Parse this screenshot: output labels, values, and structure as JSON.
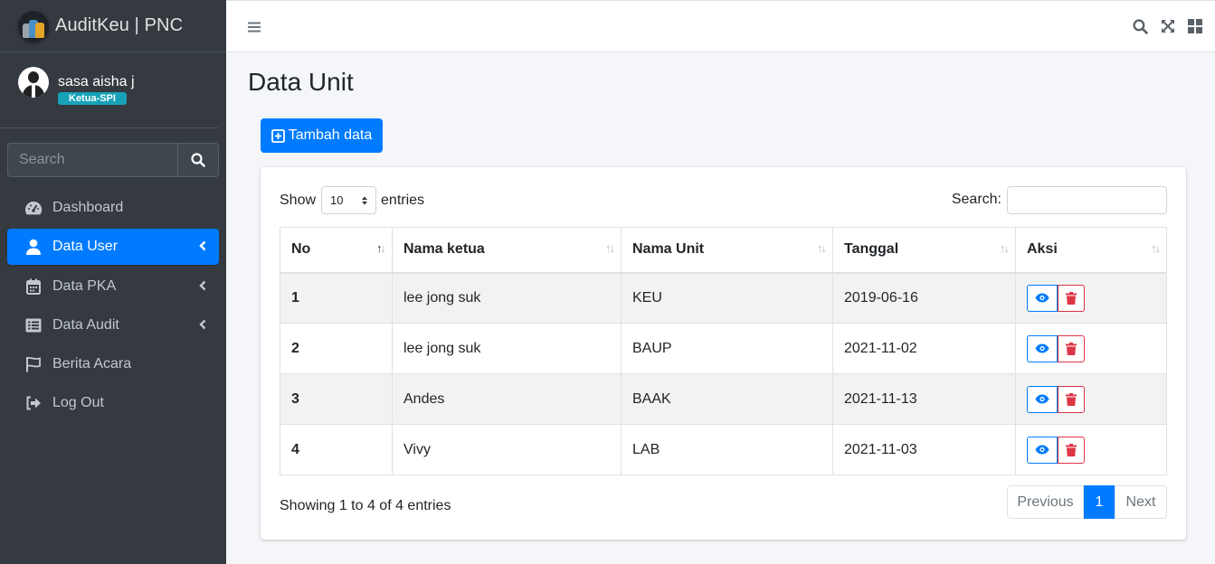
{
  "brand": {
    "title": "AuditKeu | PNC"
  },
  "user": {
    "name": "sasa aisha j",
    "role": "Ketua-SPI"
  },
  "sidebar_search": {
    "placeholder": "Search"
  },
  "nav": [
    {
      "label": "Dashboard",
      "icon": "tachometer-icon",
      "active": false
    },
    {
      "label": "Data User",
      "icon": "user-icon",
      "active": true
    },
    {
      "label": "Data PKA",
      "icon": "calendar-icon",
      "active": false
    },
    {
      "label": "Data Audit",
      "icon": "list-icon",
      "active": false
    },
    {
      "label": "Berita Acara",
      "icon": "flag-icon",
      "active": false
    },
    {
      "label": "Log Out",
      "icon": "sign-out-icon",
      "active": false
    }
  ],
  "page": {
    "title": "Data Unit",
    "add_button": "Tambah data"
  },
  "table_controls": {
    "show_label": "Show",
    "entries_value": "10",
    "entries_label": "entries",
    "search_label": "Search:"
  },
  "table": {
    "headers": [
      "No",
      "Nama ketua",
      "Nama Unit",
      "Tanggal",
      "Aksi"
    ],
    "rows": [
      {
        "no": "1",
        "ketua": "lee jong suk",
        "unit": "KEU",
        "tanggal": "2019-06-16"
      },
      {
        "no": "2",
        "ketua": "lee jong suk",
        "unit": "BAUP",
        "tanggal": "2021-11-02"
      },
      {
        "no": "3",
        "ketua": "Andes",
        "unit": "BAAK",
        "tanggal": "2021-11-13"
      },
      {
        "no": "4",
        "ketua": "Vivy",
        "unit": "LAB",
        "tanggal": "2021-11-03"
      }
    ]
  },
  "footer": {
    "info": "Showing 1 to 4 of 4 entries",
    "prev": "Previous",
    "page": "1",
    "next": "Next"
  },
  "colors": {
    "primary": "#007bff",
    "danger": "#dc3545",
    "sidebar": "#343a40",
    "badge": "#17a2b8"
  }
}
